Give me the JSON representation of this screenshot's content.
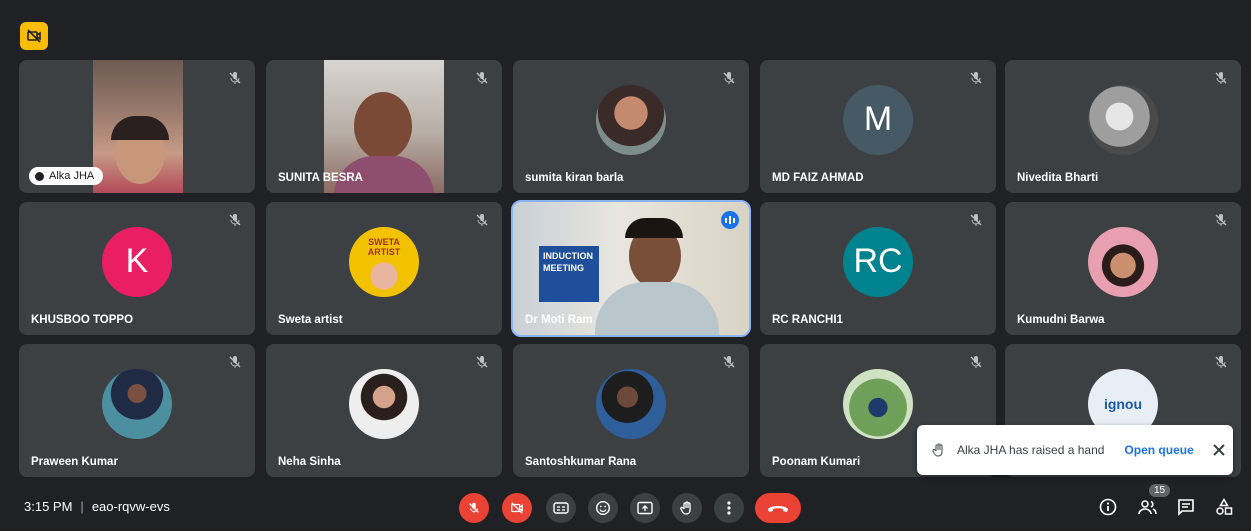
{
  "participants": [
    {
      "name": "Alka JHA"
    },
    {
      "name": "SUNITA BESRA"
    },
    {
      "name": "sumita kiran barla"
    },
    {
      "name": "MD FAIZ AHMAD",
      "initial": "M",
      "color": "#455a64"
    },
    {
      "name": "Nivedita Bharti"
    },
    {
      "name": "KHUSBOO TOPPO",
      "initial": "K",
      "color": "#e91e63"
    },
    {
      "name": "Sweta artist",
      "avatar_text": "SWETA ARTIST"
    },
    {
      "name": "Dr Moti Ram",
      "banner_text": "INDUCTION MEETING"
    },
    {
      "name": "RC RANCHI1",
      "initial": "RC",
      "color": "#00838f"
    },
    {
      "name": "Kumudni Barwa"
    },
    {
      "name": "Praween Kumar"
    },
    {
      "name": "Neha Sinha"
    },
    {
      "name": "Santoshkumar Rana"
    },
    {
      "name": "Poonam Kumari"
    },
    {
      "name": "",
      "avatar_text": "ignou"
    }
  ],
  "toast": {
    "message": "Alka JHA has raised a hand",
    "action": "Open queue"
  },
  "bottom_bar": {
    "time": "3:15 PM",
    "separator": "|",
    "meeting_code": "eao-rqvw-evs",
    "participant_count": "15"
  },
  "colors": {
    "background": "#202124",
    "tile": "#3c4043",
    "accent": "#8ab4f8",
    "danger": "#ea4335",
    "badge": "#fbbc04"
  },
  "icons": [
    "mic-off-icon",
    "camera-off-icon",
    "captions-icon",
    "emoji-icon",
    "present-icon",
    "raise-hand-icon",
    "more-icon",
    "end-call-icon",
    "info-icon",
    "people-icon",
    "chat-icon",
    "activities-icon"
  ]
}
